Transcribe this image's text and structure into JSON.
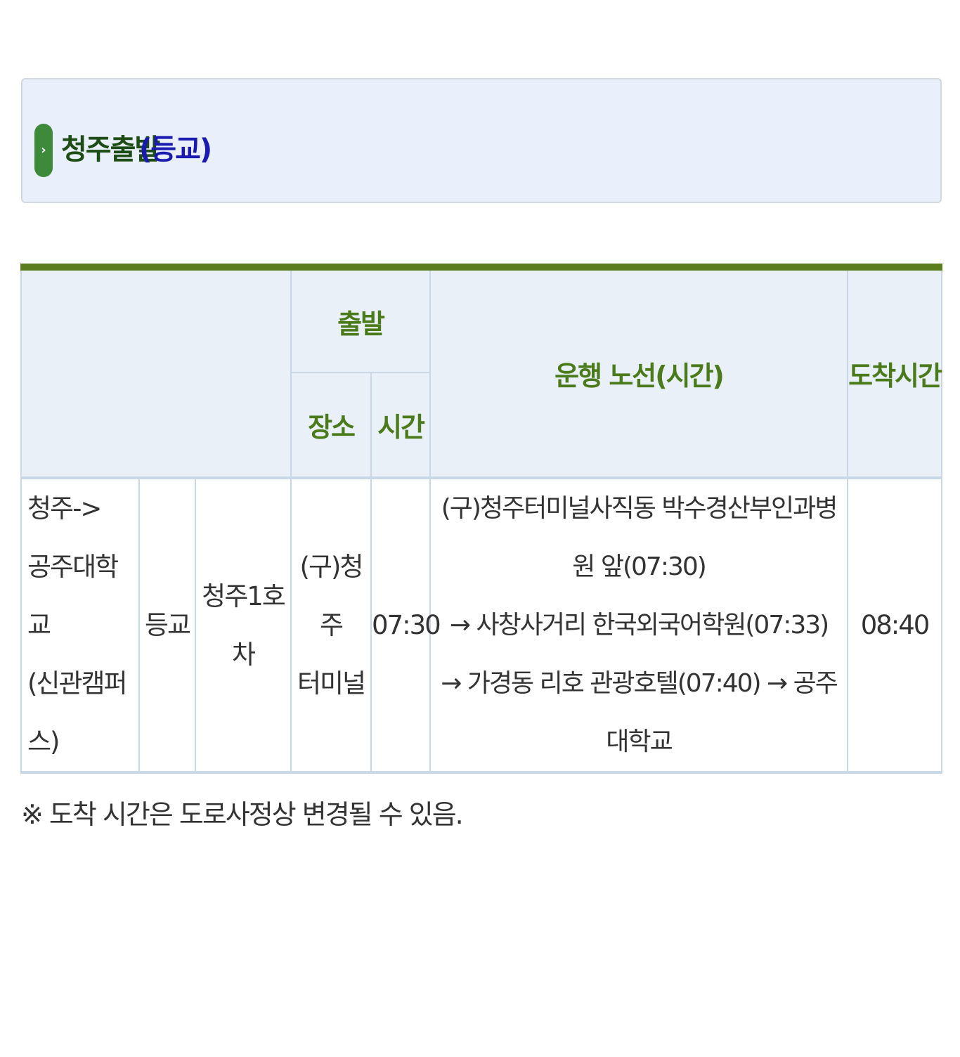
{
  "header": {
    "bullet_icon": "chevron-right-icon",
    "title": "청주출발",
    "subtitle": "(등교)"
  },
  "table": {
    "headers": {
      "empty": "",
      "departure": "출발",
      "place": "장소",
      "time": "시간",
      "route": "운행 노선(시간)",
      "arrival": "도착시간"
    },
    "row": {
      "section_lines": [
        "청주->",
        "공주대학교",
        "(신관캠퍼스)"
      ],
      "type": "등교",
      "vehicle": "청주1호차",
      "place_lines": [
        "(구)청주",
        "터미널"
      ],
      "time": "07:30",
      "route_lines": [
        "(구)청주터미널사직동 박수경산부인과병원 앞(07:30)",
        "→ 사창사거리 한국외국어학원(07:33)",
        "→ 가경동 리호 관광호텔(07:40) → 공주대학교"
      ],
      "arrival": "08:40"
    }
  },
  "note": "※ 도착 시간은 도로사정상 변경될 수 있음.",
  "colors": {
    "header_bg": "#e9f0fb",
    "title_green": "#1d4c14",
    "subtitle_blue": "#1a1ab0",
    "table_top_border": "#5c7d1e",
    "th_text": "#4a7a1a",
    "border": "#c8d8e6"
  }
}
